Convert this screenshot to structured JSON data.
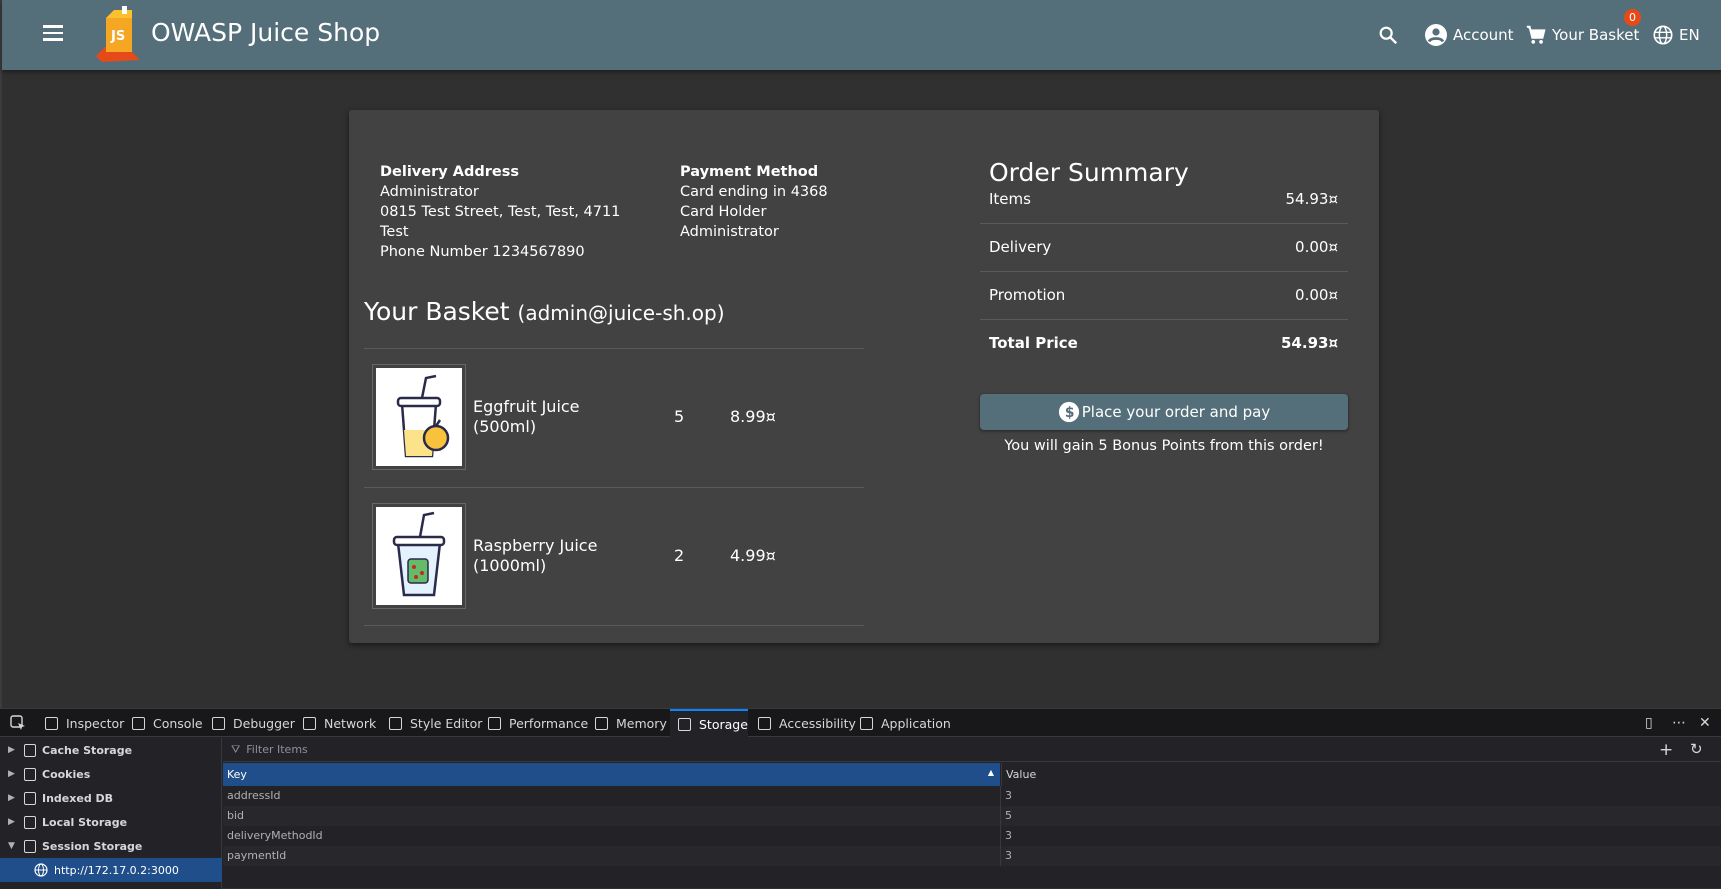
{
  "toolbar": {
    "title": "OWASP Juice Shop",
    "account_label": "Account",
    "basket_label": "Your Basket",
    "basket_count": "0",
    "language": "EN"
  },
  "delivery": {
    "heading": "Delivery Address",
    "name": "Administrator",
    "street": "0815 Test Street, Test, Test, 4711",
    "country": "Test",
    "phone": "Phone Number 1234567890"
  },
  "payment": {
    "heading": "Payment Method",
    "card": "Card ending in 4368",
    "holder_label": "Card Holder",
    "holder": "Administrator"
  },
  "basket": {
    "title": "Your Basket",
    "email": "(admin@juice-sh.op)",
    "items": [
      {
        "name": "Eggfruit Juice (500ml)",
        "qty": "5",
        "price": "8.99¤"
      },
      {
        "name": "Raspberry Juice (1000ml)",
        "qty": "2",
        "price": "4.99¤"
      }
    ]
  },
  "summary": {
    "title": "Order Summary",
    "rows": [
      {
        "label": "Items",
        "value": "54.93¤"
      },
      {
        "label": "Delivery",
        "value": "0.00¤"
      },
      {
        "label": "Promotion",
        "value": "0.00¤"
      },
      {
        "label": "Total Price",
        "value": "54.93¤"
      }
    ],
    "button": "Place your order and pay",
    "bonus": "You will gain 5 Bonus Points from this order!"
  },
  "devtools": {
    "tabs": [
      "Inspector",
      "Console",
      "Debugger",
      "Network",
      "Style Editor",
      "Performance",
      "Memory",
      "Storage",
      "Accessibility",
      "Application"
    ],
    "tree": [
      "Cache Storage",
      "Cookies",
      "Indexed DB",
      "Local Storage",
      "Session Storage"
    ],
    "selected_origin": "http://172.17.0.2:3000",
    "filter_placeholder": "Filter Items",
    "col_key": "Key",
    "col_value": "Value",
    "rows": [
      {
        "key": "addressId",
        "value": "3"
      },
      {
        "key": "bid",
        "value": "5"
      },
      {
        "key": "deliveryMethodId",
        "value": "3"
      },
      {
        "key": "paymentId",
        "value": "3"
      }
    ]
  }
}
